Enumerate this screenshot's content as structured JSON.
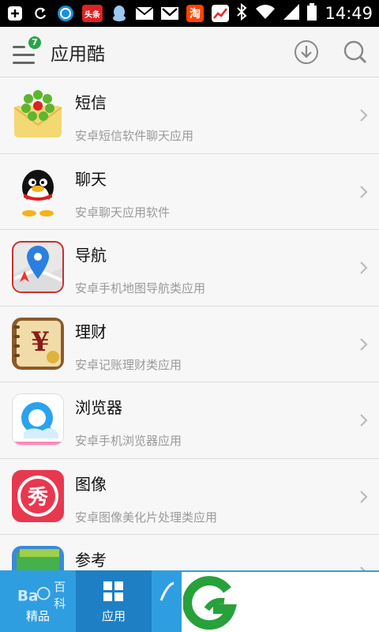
{
  "status_bar": {
    "time": "14:49",
    "toutiao_label": "头条",
    "taobao_label": "淘"
  },
  "header": {
    "title": "应用酷",
    "badge_count": "7"
  },
  "categories": [
    {
      "name": "短信",
      "desc": "安卓短信软件聊天应用",
      "icon": "icq-flower-envelope-icon"
    },
    {
      "name": "聊天",
      "desc": "安卓聊天应用软件",
      "icon": "qq-penguin-icon"
    },
    {
      "name": "导航",
      "desc": "安卓手机地图导航类应用",
      "icon": "map-pin-icon"
    },
    {
      "name": "理财",
      "desc": "安卓记账理财类应用",
      "icon": "yen-book-icon"
    },
    {
      "name": "浏览器",
      "desc": "安卓手机浏览器应用",
      "icon": "browser-q-icon"
    },
    {
      "name": "图像",
      "desc": "安卓图像美化片处理类应用",
      "icon": "xiu-photo-icon"
    },
    {
      "name": "参考",
      "desc": "",
      "icon": "reference-card-icon"
    }
  ],
  "bottom_nav": {
    "tabs": [
      {
        "label": "精品"
      },
      {
        "label": "应用"
      }
    ],
    "baidu_logo_text": "百科",
    "xiu_glyph": "秀",
    "yen_glyph": "¥"
  },
  "colors": {
    "nav_blue": "#2f9ee0",
    "nav_active": "#1e7fc4",
    "badge_green": "#2aa44a"
  }
}
